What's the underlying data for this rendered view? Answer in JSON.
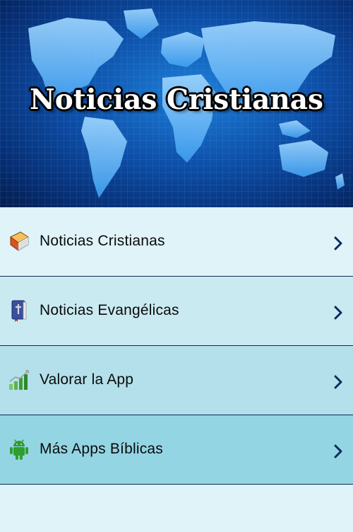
{
  "banner": {
    "title": "Noticias Cristianas"
  },
  "menu": {
    "items": [
      {
        "label": "Noticias Cristianas",
        "icon": "book-icon"
      },
      {
        "label": "Noticias Evangélicas",
        "icon": "bible-icon"
      },
      {
        "label": "Valorar la App",
        "icon": "bar-chart-icon"
      },
      {
        "label": "Más Apps Bíblicas",
        "icon": "android-icon"
      }
    ]
  },
  "colors": {
    "chevron": "#0d2a5e",
    "divider": "#0f2b52",
    "banner_blue": "#0d4fa8"
  }
}
